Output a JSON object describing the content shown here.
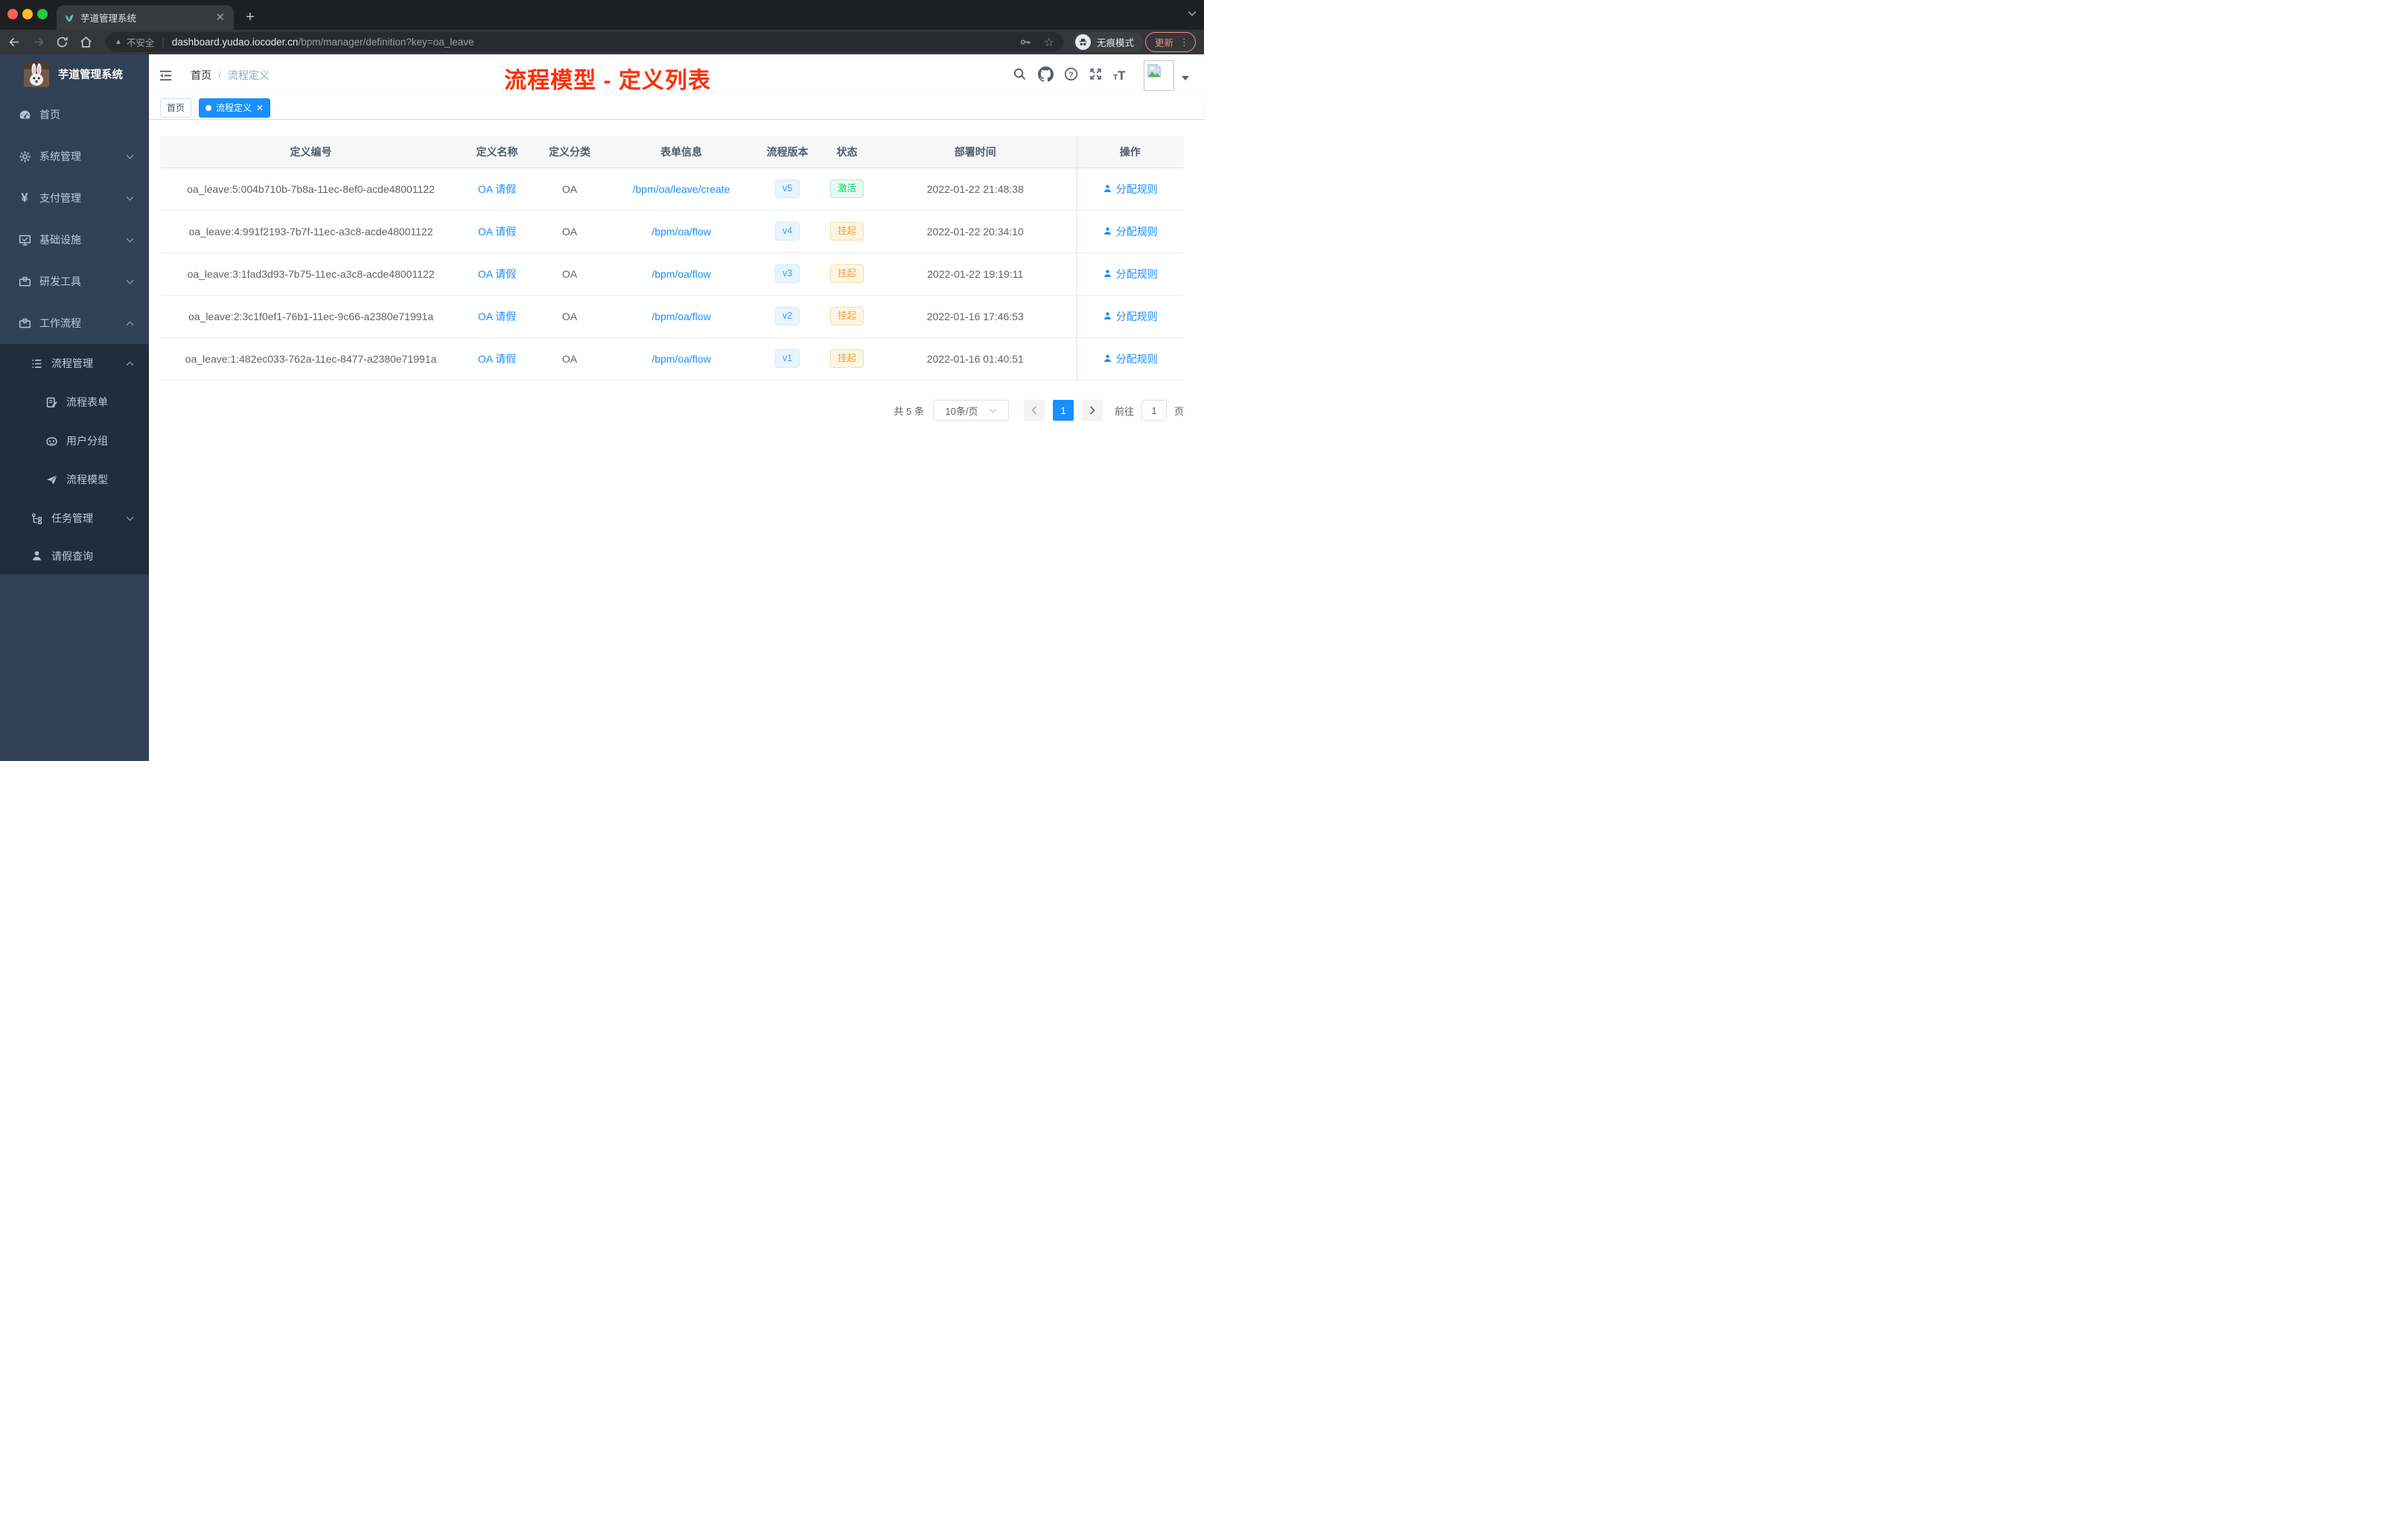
{
  "browser": {
    "tab_title": "芋道管理系统",
    "security_label": "不安全",
    "url_host": "dashboard.yudao.iocoder.cn",
    "url_path": "/bpm/manager/definition?key=oa_leave",
    "incognito_label": "无痕模式",
    "update_label": "更新"
  },
  "sidebar": {
    "app_title": "芋道管理系统",
    "items": [
      {
        "label": "首页",
        "icon": "dashboard-icon"
      },
      {
        "label": "系统管理",
        "icon": "gear-icon",
        "chevron": "down"
      },
      {
        "label": "支付管理",
        "icon": "yuan-icon",
        "chevron": "down"
      },
      {
        "label": "基础设施",
        "icon": "monitor-icon",
        "chevron": "down"
      },
      {
        "label": "研发工具",
        "icon": "toolbox-icon",
        "chevron": "down"
      },
      {
        "label": "工作流程",
        "icon": "toolbox-icon",
        "chevron": "up"
      },
      {
        "label": "流程管理",
        "icon": "tree-list-icon",
        "chevron": "up"
      },
      {
        "label": "流程表单",
        "icon": "form-icon"
      },
      {
        "label": "用户分组",
        "icon": "robot-icon"
      },
      {
        "label": "流程模型",
        "icon": "paper-plane-icon"
      },
      {
        "label": "任务管理",
        "icon": "flow-icon",
        "chevron": "down"
      },
      {
        "label": "请假查询",
        "icon": "user-icon"
      }
    ]
  },
  "header": {
    "breadcrumb_home": "首页",
    "breadcrumb_current": "流程定义",
    "annotation": "流程模型 - 定义列表"
  },
  "tags": [
    {
      "label": "首页",
      "active": false
    },
    {
      "label": "流程定义",
      "active": true
    }
  ],
  "table": {
    "columns": [
      "定义编号",
      "定义名称",
      "定义分类",
      "表单信息",
      "流程版本",
      "状态",
      "部署时间",
      "操作"
    ],
    "rows": [
      {
        "id": "oa_leave:5:004b710b-7b8a-11ec-8ef0-acde48001122",
        "name": "OA 请假",
        "category": "OA",
        "form": "/bpm/oa/leave/create",
        "version": "v5",
        "status": "激活",
        "time": "2022-01-22 21:48:38",
        "action": "分配规则"
      },
      {
        "id": "oa_leave:4:991f2193-7b7f-11ec-a3c8-acde48001122",
        "name": "OA 请假",
        "category": "OA",
        "form": "/bpm/oa/flow",
        "version": "v4",
        "status": "挂起",
        "time": "2022-01-22 20:34:10",
        "action": "分配规则"
      },
      {
        "id": "oa_leave:3:1fad3d93-7b75-11ec-a3c8-acde48001122",
        "name": "OA 请假",
        "category": "OA",
        "form": "/bpm/oa/flow",
        "version": "v3",
        "status": "挂起",
        "time": "2022-01-22 19:19:11",
        "action": "分配规则"
      },
      {
        "id": "oa_leave:2:3c1f0ef1-76b1-11ec-9c66-a2380e71991a",
        "name": "OA 请假",
        "category": "OA",
        "form": "/bpm/oa/flow",
        "version": "v2",
        "status": "挂起",
        "time": "2022-01-16 17:46:53",
        "action": "分配规则"
      },
      {
        "id": "oa_leave:1:482ec033-762a-11ec-8477-a2380e71991a",
        "name": "OA 请假",
        "category": "OA",
        "form": "/bpm/oa/flow",
        "version": "v1",
        "status": "挂起",
        "time": "2022-01-16 01:40:51",
        "action": "分配规则"
      }
    ]
  },
  "pagination": {
    "total_label": "共 5 条",
    "page_size": "10条/页",
    "current_page": "1",
    "goto_label": "前往",
    "goto_value": "1",
    "page_suffix": "页"
  },
  "colors": {
    "accent_blue": "#1890ff",
    "annotation_red": "#ff2f00",
    "sidebar_bg": "#304156",
    "sidebar_submenu_bg": "#1f2d3d",
    "sidebar_text": "#bfcbd9",
    "status_active_green": "#13ce66",
    "status_suspended_orange": "#efa23c",
    "version_badge_blue": "#3a9cff"
  }
}
